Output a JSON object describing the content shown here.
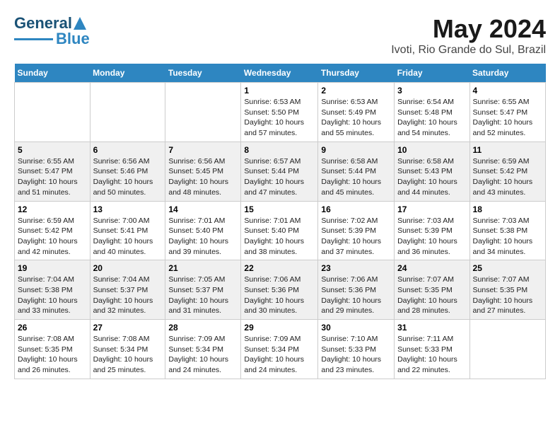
{
  "logo": {
    "line1": "General",
    "line2": "Blue"
  },
  "title": "May 2024",
  "subtitle": "Ivoti, Rio Grande do Sul, Brazil",
  "weekdays": [
    "Sunday",
    "Monday",
    "Tuesday",
    "Wednesday",
    "Thursday",
    "Friday",
    "Saturday"
  ],
  "weeks": [
    [
      {
        "day": "",
        "info": ""
      },
      {
        "day": "",
        "info": ""
      },
      {
        "day": "",
        "info": ""
      },
      {
        "day": "1",
        "info": "Sunrise: 6:53 AM\nSunset: 5:50 PM\nDaylight: 10 hours\nand 57 minutes."
      },
      {
        "day": "2",
        "info": "Sunrise: 6:53 AM\nSunset: 5:49 PM\nDaylight: 10 hours\nand 55 minutes."
      },
      {
        "day": "3",
        "info": "Sunrise: 6:54 AM\nSunset: 5:48 PM\nDaylight: 10 hours\nand 54 minutes."
      },
      {
        "day": "4",
        "info": "Sunrise: 6:55 AM\nSunset: 5:47 PM\nDaylight: 10 hours\nand 52 minutes."
      }
    ],
    [
      {
        "day": "5",
        "info": "Sunrise: 6:55 AM\nSunset: 5:47 PM\nDaylight: 10 hours\nand 51 minutes."
      },
      {
        "day": "6",
        "info": "Sunrise: 6:56 AM\nSunset: 5:46 PM\nDaylight: 10 hours\nand 50 minutes."
      },
      {
        "day": "7",
        "info": "Sunrise: 6:56 AM\nSunset: 5:45 PM\nDaylight: 10 hours\nand 48 minutes."
      },
      {
        "day": "8",
        "info": "Sunrise: 6:57 AM\nSunset: 5:44 PM\nDaylight: 10 hours\nand 47 minutes."
      },
      {
        "day": "9",
        "info": "Sunrise: 6:58 AM\nSunset: 5:44 PM\nDaylight: 10 hours\nand 45 minutes."
      },
      {
        "day": "10",
        "info": "Sunrise: 6:58 AM\nSunset: 5:43 PM\nDaylight: 10 hours\nand 44 minutes."
      },
      {
        "day": "11",
        "info": "Sunrise: 6:59 AM\nSunset: 5:42 PM\nDaylight: 10 hours\nand 43 minutes."
      }
    ],
    [
      {
        "day": "12",
        "info": "Sunrise: 6:59 AM\nSunset: 5:42 PM\nDaylight: 10 hours\nand 42 minutes."
      },
      {
        "day": "13",
        "info": "Sunrise: 7:00 AM\nSunset: 5:41 PM\nDaylight: 10 hours\nand 40 minutes."
      },
      {
        "day": "14",
        "info": "Sunrise: 7:01 AM\nSunset: 5:40 PM\nDaylight: 10 hours\nand 39 minutes."
      },
      {
        "day": "15",
        "info": "Sunrise: 7:01 AM\nSunset: 5:40 PM\nDaylight: 10 hours\nand 38 minutes."
      },
      {
        "day": "16",
        "info": "Sunrise: 7:02 AM\nSunset: 5:39 PM\nDaylight: 10 hours\nand 37 minutes."
      },
      {
        "day": "17",
        "info": "Sunrise: 7:03 AM\nSunset: 5:39 PM\nDaylight: 10 hours\nand 36 minutes."
      },
      {
        "day": "18",
        "info": "Sunrise: 7:03 AM\nSunset: 5:38 PM\nDaylight: 10 hours\nand 34 minutes."
      }
    ],
    [
      {
        "day": "19",
        "info": "Sunrise: 7:04 AM\nSunset: 5:38 PM\nDaylight: 10 hours\nand 33 minutes."
      },
      {
        "day": "20",
        "info": "Sunrise: 7:04 AM\nSunset: 5:37 PM\nDaylight: 10 hours\nand 32 minutes."
      },
      {
        "day": "21",
        "info": "Sunrise: 7:05 AM\nSunset: 5:37 PM\nDaylight: 10 hours\nand 31 minutes."
      },
      {
        "day": "22",
        "info": "Sunrise: 7:06 AM\nSunset: 5:36 PM\nDaylight: 10 hours\nand 30 minutes."
      },
      {
        "day": "23",
        "info": "Sunrise: 7:06 AM\nSunset: 5:36 PM\nDaylight: 10 hours\nand 29 minutes."
      },
      {
        "day": "24",
        "info": "Sunrise: 7:07 AM\nSunset: 5:35 PM\nDaylight: 10 hours\nand 28 minutes."
      },
      {
        "day": "25",
        "info": "Sunrise: 7:07 AM\nSunset: 5:35 PM\nDaylight: 10 hours\nand 27 minutes."
      }
    ],
    [
      {
        "day": "26",
        "info": "Sunrise: 7:08 AM\nSunset: 5:35 PM\nDaylight: 10 hours\nand 26 minutes."
      },
      {
        "day": "27",
        "info": "Sunrise: 7:08 AM\nSunset: 5:34 PM\nDaylight: 10 hours\nand 25 minutes."
      },
      {
        "day": "28",
        "info": "Sunrise: 7:09 AM\nSunset: 5:34 PM\nDaylight: 10 hours\nand 24 minutes."
      },
      {
        "day": "29",
        "info": "Sunrise: 7:09 AM\nSunset: 5:34 PM\nDaylight: 10 hours\nand 24 minutes."
      },
      {
        "day": "30",
        "info": "Sunrise: 7:10 AM\nSunset: 5:33 PM\nDaylight: 10 hours\nand 23 minutes."
      },
      {
        "day": "31",
        "info": "Sunrise: 7:11 AM\nSunset: 5:33 PM\nDaylight: 10 hours\nand 22 minutes."
      },
      {
        "day": "",
        "info": ""
      }
    ]
  ]
}
